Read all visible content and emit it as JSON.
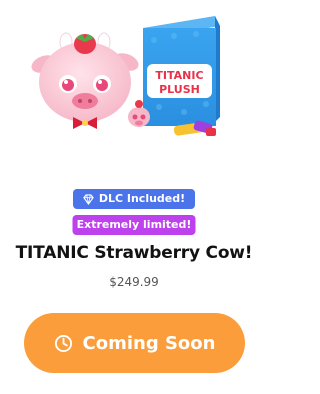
{
  "product": {
    "image_label": "TITANIC PLUSH",
    "badges": [
      {
        "label": "DLC Included!",
        "icon": "diamond-icon",
        "color": "#4b74ea"
      },
      {
        "label": "Extremely limited!",
        "color": "#bd42ee"
      }
    ],
    "title": "TITANIC Strawberry Cow!",
    "price": "$249.99",
    "button": {
      "label": "Coming Soon",
      "icon": "clock-icon",
      "color": "#fb9d3a"
    }
  }
}
